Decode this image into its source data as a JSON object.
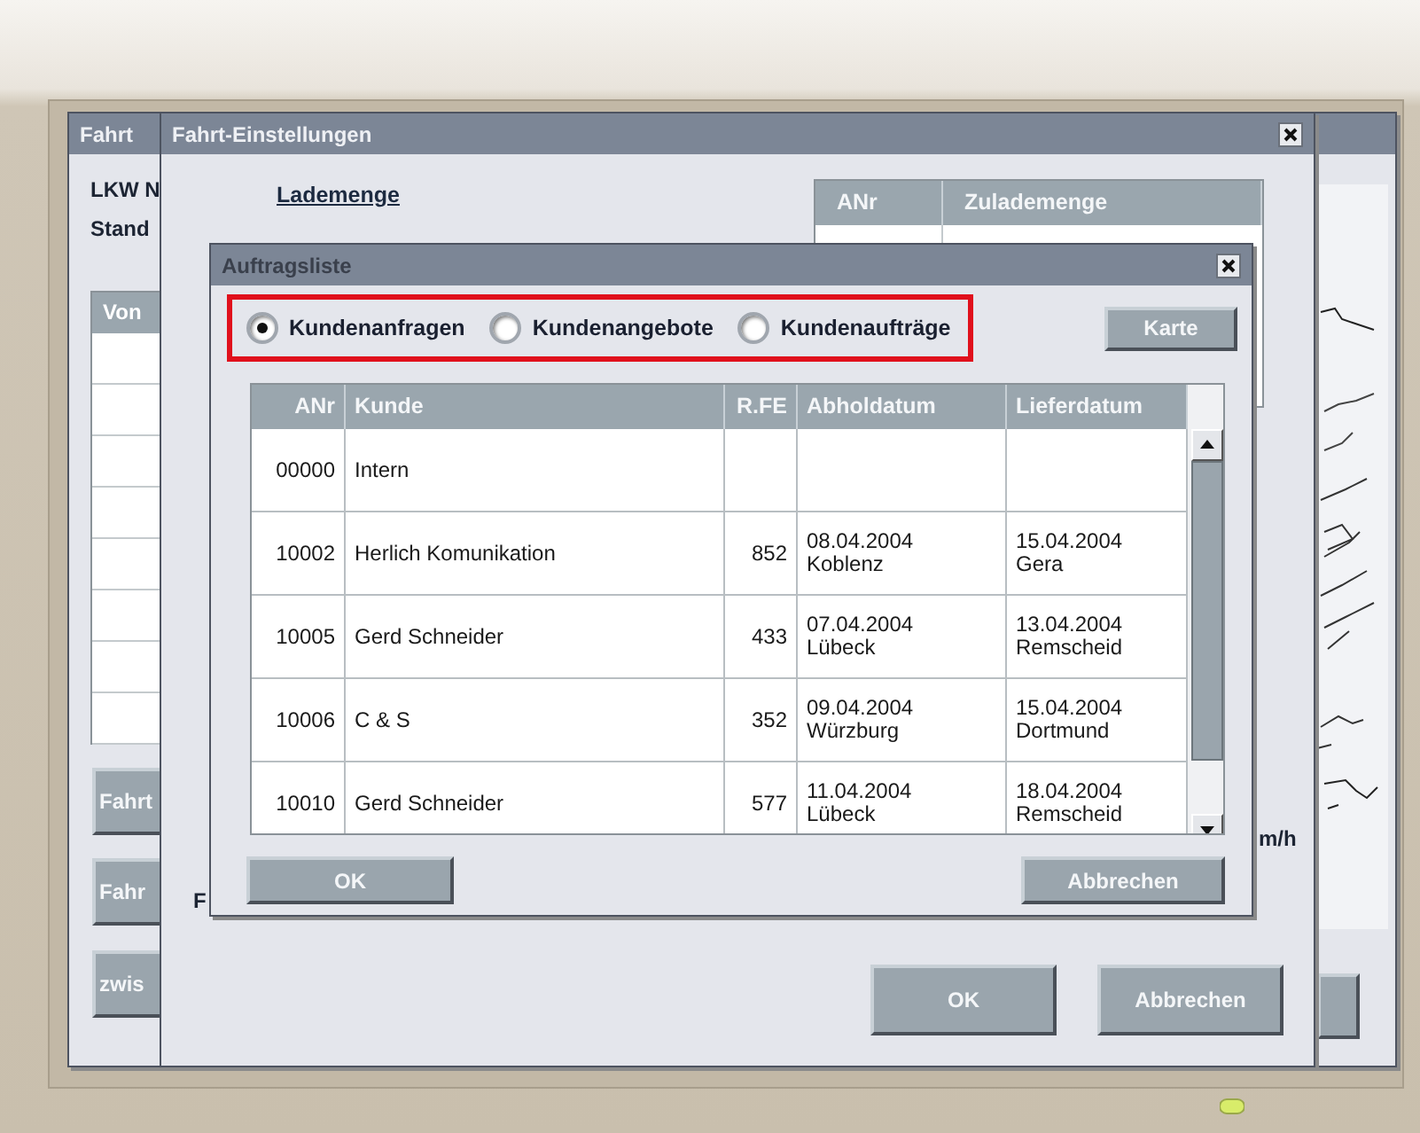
{
  "back_window": {
    "title": "Fahrt",
    "labels": [
      "LKW N",
      "Stand"
    ],
    "table_header": "Von",
    "buttons": [
      "Fahrt",
      "Fahr",
      "zwis"
    ]
  },
  "settings_window": {
    "title": "Fahrt-Einstellungen",
    "heading": "Lademenge",
    "table_columns": [
      "ANr",
      "Zulademenge"
    ],
    "label_fragments": [
      "F",
      "m/h"
    ],
    "buttons": [
      "OK",
      "Abbrechen"
    ]
  },
  "order_dialog": {
    "title": "Auftragsliste",
    "radios": [
      {
        "label": "Kundenanfragen",
        "selected": true
      },
      {
        "label": "Kundenangebote",
        "selected": false
      },
      {
        "label": "Kundenaufträge",
        "selected": false
      }
    ],
    "map_button": "Karte",
    "columns": [
      "ANr",
      "Kunde",
      "R.FE",
      "Abholdatum",
      "Lieferdatum"
    ],
    "rows": [
      {
        "anr": "00000",
        "kunde": "Intern"
      },
      {
        "anr": "10002",
        "kunde": "Herlich Komunikation",
        "rfe": "852",
        "pickup_date": "08.04.2004",
        "pickup_place": "Koblenz",
        "delivery_date": "15.04.2004",
        "delivery_place": "Gera"
      },
      {
        "anr": "10005",
        "kunde": "Gerd Schneider",
        "rfe": "433",
        "pickup_date": "07.04.2004",
        "pickup_place": "Lübeck",
        "delivery_date": "13.04.2004",
        "delivery_place": "Remscheid"
      },
      {
        "anr": "10006",
        "kunde": "C & S",
        "rfe": "352",
        "pickup_date": "09.04.2004",
        "pickup_place": "Würzburg",
        "delivery_date": "15.04.2004",
        "delivery_place": "Dortmund"
      },
      {
        "anr": "10010",
        "kunde": "Gerd Schneider",
        "rfe": "577",
        "pickup_date": "11.04.2004",
        "pickup_place": "Lübeck",
        "delivery_date": "18.04.2004",
        "delivery_place": "Remscheid"
      }
    ],
    "buttons": [
      "OK",
      "Abbrechen"
    ]
  }
}
